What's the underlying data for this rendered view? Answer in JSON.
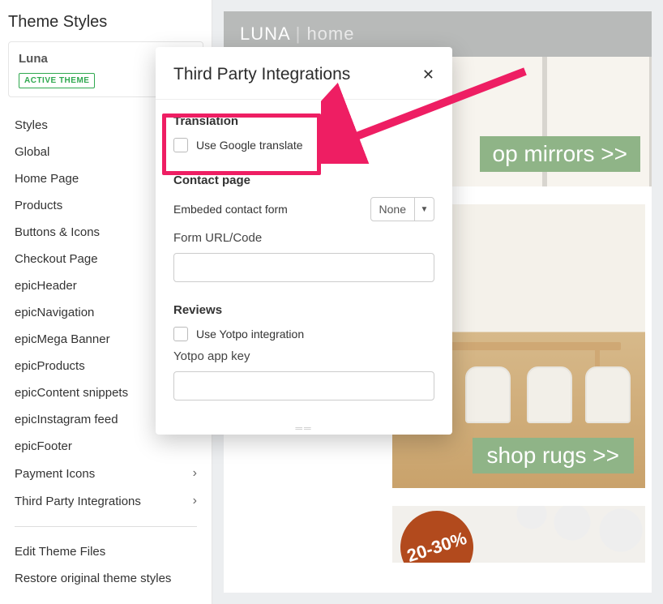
{
  "sidebar": {
    "title": "Theme Styles",
    "theme": {
      "name": "Luna",
      "badge": "ACTIVE THEME"
    },
    "items": [
      {
        "label": "Styles",
        "chevron": false
      },
      {
        "label": "Global",
        "chevron": false
      },
      {
        "label": "Home Page",
        "chevron": false
      },
      {
        "label": "Products",
        "chevron": false
      },
      {
        "label": "Buttons & Icons",
        "chevron": false
      },
      {
        "label": "Checkout Page",
        "chevron": false
      },
      {
        "label": "epicHeader",
        "chevron": false
      },
      {
        "label": "epicNavigation",
        "chevron": false
      },
      {
        "label": "epicMega Banner",
        "chevron": false
      },
      {
        "label": "epicProducts",
        "chevron": false
      },
      {
        "label": "epicContent snippets",
        "chevron": false
      },
      {
        "label": "epicInstagram feed",
        "chevron": false
      },
      {
        "label": "epicFooter",
        "chevron": false
      },
      {
        "label": "Payment Icons",
        "chevron": true
      },
      {
        "label": "Third Party Integrations",
        "chevron": true
      }
    ],
    "footer_items": [
      {
        "label": "Edit Theme Files"
      },
      {
        "label": "Restore original theme styles"
      }
    ]
  },
  "modal": {
    "title": "Third Party Integrations",
    "sections": {
      "translation": {
        "heading": "Translation",
        "checkbox_label": "Use Google translate"
      },
      "contact": {
        "heading": "Contact page",
        "embed_label": "Embeded contact form",
        "embed_value": "None",
        "form_url_label": "Form URL/Code",
        "form_url_value": ""
      },
      "reviews": {
        "heading": "Reviews",
        "checkbox_label": "Use Yotpo integration",
        "appkey_label": "Yotpo app key",
        "appkey_value": ""
      }
    }
  },
  "preview": {
    "brand": "LUNA",
    "brand_sub": "home",
    "banner1_cta": "op mirrors >>",
    "tile_cta": "shop rugs >>",
    "sale_text": "20-30%"
  },
  "colors": {
    "accent_pink": "#ee1e63",
    "green_cta": "#8fb487",
    "active_green": "#2fa84f",
    "sale_rust": "#b24a1d"
  }
}
